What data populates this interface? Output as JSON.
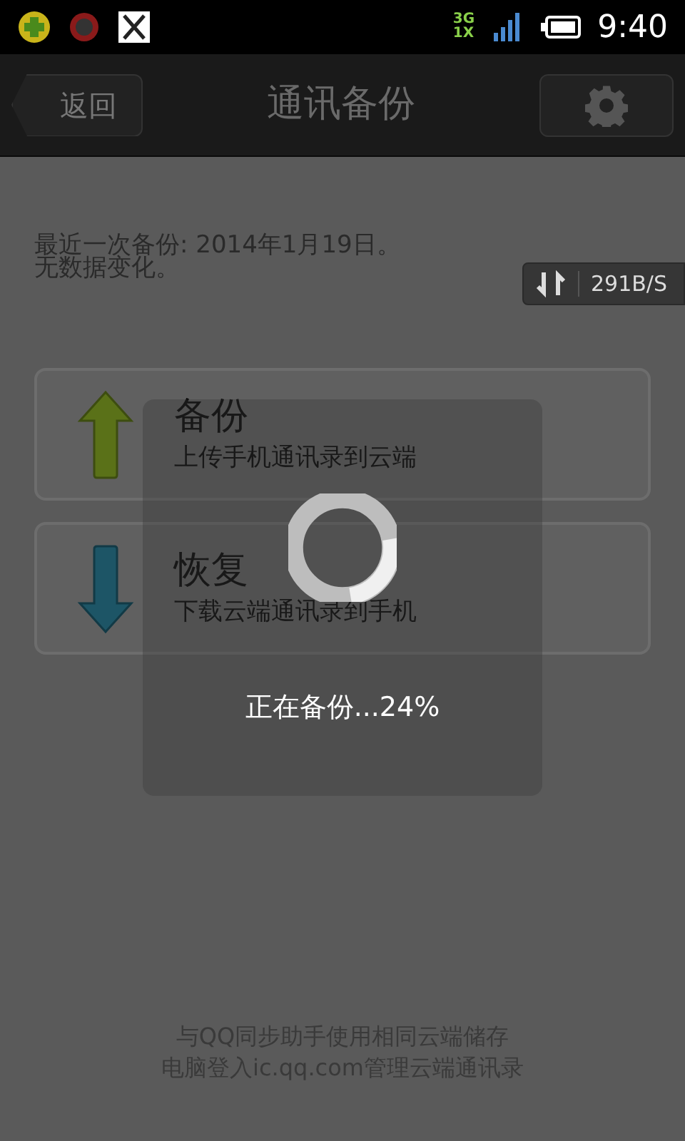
{
  "status_bar": {
    "network_top": "3G",
    "network_bottom": "1X",
    "time": "9:40"
  },
  "header": {
    "back": "返回",
    "title": "通讯备份"
  },
  "last_backup": {
    "line1": "最近一次备份: 2014年1月19日。",
    "line2": "无数据变化。"
  },
  "speed": "291B/S",
  "actions": [
    {
      "kind": "upload",
      "title": "备份",
      "subtitle": "上传手机通讯录到云端"
    },
    {
      "kind": "download",
      "title": "恢复",
      "subtitle": "下载云端通讯录到手机"
    }
  ],
  "dialog": {
    "message": "正在备份...24%"
  },
  "footer": [
    "与QQ同步助手使用相同云端储存",
    "电脑登入ic.qq.com管理云端通讯录"
  ]
}
